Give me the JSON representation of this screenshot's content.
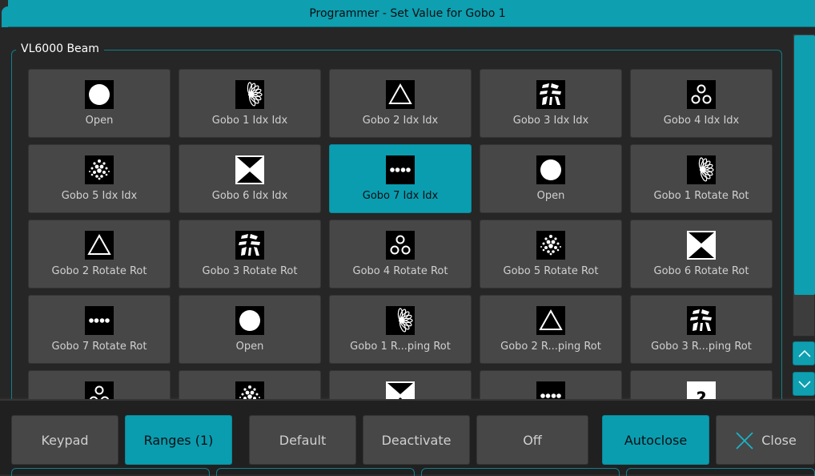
{
  "window": {
    "title": "Programmer - Set Value for Gobo 1"
  },
  "group": {
    "label": "VL6000 Beam"
  },
  "cells": [
    {
      "label": "Open",
      "icon": "open-circle-icon"
    },
    {
      "label": "Gobo 1 Idx Idx",
      "icon": "star-burst-gobo-icon"
    },
    {
      "label": "Gobo 2 Idx Idx",
      "icon": "triangle-gobo-icon"
    },
    {
      "label": "Gobo 3 Idx Idx",
      "icon": "shards-gobo-icon"
    },
    {
      "label": "Gobo 4 Idx Idx",
      "icon": "three-rings-gobo-icon"
    },
    {
      "label": "Gobo 5 Idx Idx",
      "icon": "dot-cluster-gobo-icon"
    },
    {
      "label": "Gobo 6 Idx Idx",
      "icon": "four-triangles-gobo-icon"
    },
    {
      "label": "Gobo 7 Idx Idx",
      "icon": "dot-row-gobo-icon"
    },
    {
      "label": "Open",
      "icon": "open-circle-icon"
    },
    {
      "label": "Gobo 1 Rotate Rot",
      "icon": "star-burst-gobo-icon"
    },
    {
      "label": "Gobo 2 Rotate Rot",
      "icon": "triangle-gobo-icon"
    },
    {
      "label": "Gobo 3 Rotate Rot",
      "icon": "shards-gobo-icon"
    },
    {
      "label": "Gobo 4 Rotate Rot",
      "icon": "three-rings-gobo-icon"
    },
    {
      "label": "Gobo 5 Rotate Rot",
      "icon": "dot-cluster-gobo-icon"
    },
    {
      "label": "Gobo 6 Rotate Rot",
      "icon": "four-triangles-gobo-icon"
    },
    {
      "label": "Gobo 7 Rotate Rot",
      "icon": "dot-row-gobo-icon"
    },
    {
      "label": "Open",
      "icon": "open-circle-icon"
    },
    {
      "label": "Gobo 1 R...ping Rot",
      "icon": "star-burst-gobo-icon"
    },
    {
      "label": "Gobo 2 R...ping Rot",
      "icon": "triangle-gobo-icon"
    },
    {
      "label": "Gobo 3 R...ping Rot",
      "icon": "shards-gobo-icon"
    },
    {
      "label": "",
      "icon": "three-rings-gobo-icon"
    },
    {
      "label": "",
      "icon": "dot-cluster-gobo-icon"
    },
    {
      "label": "",
      "icon": "four-triangles-gobo-icon"
    },
    {
      "label": "",
      "icon": "dot-row-gobo-icon"
    },
    {
      "label": "",
      "icon": "unknown-question-icon"
    }
  ],
  "selected_cell_label": "Gobo 7 Idx Idx",
  "unknown_icon_glyph": "?",
  "buttons": {
    "keypad": "Keypad",
    "ranges": "Ranges (1)",
    "default": "Default",
    "deactivate": "Deactivate",
    "off": "Off",
    "autoclose": "Autoclose",
    "close": "Close"
  },
  "colors": {
    "accent": "#0e9fb0",
    "cell": "#474747",
    "background": "#262626"
  }
}
